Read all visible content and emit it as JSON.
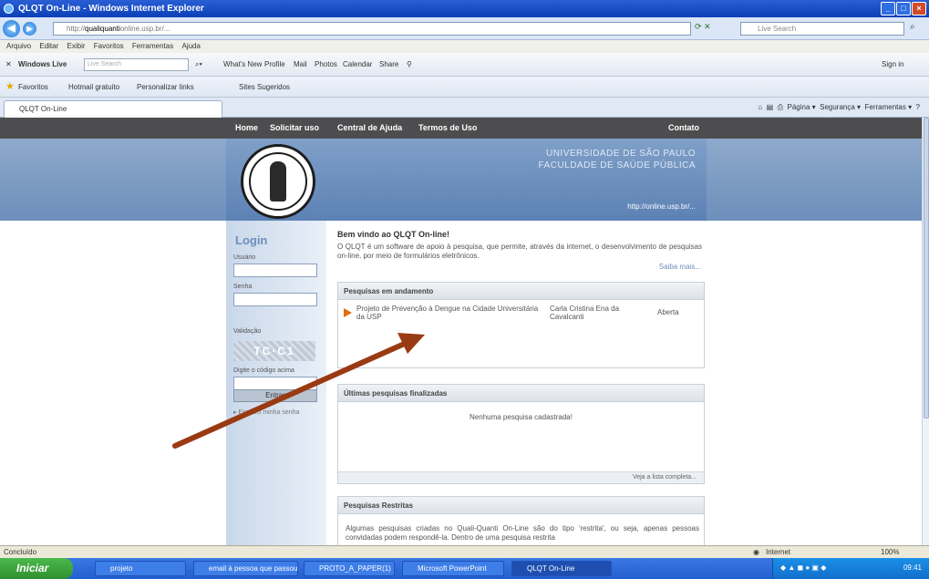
{
  "window": {
    "title": "QLQT On-Line - Windows Internet Explorer",
    "buttons": [
      "minimize",
      "maximize",
      "close"
    ]
  },
  "address": {
    "url_prefix": "http://",
    "url_strong": "qualiquanti",
    "url_rest": "online.usp.br/...",
    "search_placeholder": "Live Search"
  },
  "menu": [
    "Arquivo",
    "Editar",
    "Exibir",
    "Favoritos",
    "Ferramentas",
    "Ajuda"
  ],
  "toolbar2": {
    "windows_live": "Windows Live",
    "search_placeholder": "Live Search",
    "links": [
      "What's New",
      "Profile",
      "Mail",
      "Photos",
      "Calendar",
      "Share"
    ],
    "signin": "Sign in"
  },
  "favorites": {
    "label": "Favoritos",
    "items": [
      "Hotmail gratuito",
      "Personalizar links",
      "Sites Sugeridos"
    ]
  },
  "tab": {
    "title": "QLQT On-Line",
    "commands": [
      "Página",
      "Segurança",
      "Ferramentas"
    ]
  },
  "site": {
    "nav": [
      "Home",
      "Solicitar uso",
      "Central de Ajuda",
      "Termos de Uso",
      "Contato"
    ],
    "university": [
      "UNIVERSIDADE DE SÃO PAULO",
      "FACULDADE DE SAÚDE PÚBLICA"
    ],
    "url": "http://online.usp.br/..."
  },
  "login": {
    "title": "Login",
    "user_label": "Usuário",
    "password_label": "Senha",
    "validation_label": "Validação",
    "captcha": "TC·C1",
    "code_label": "Digite o código acima",
    "enter": "Entrar",
    "forgot": "Esqueci minha senha"
  },
  "main": {
    "welcome": "Bem vindo ao QLQT On-line!",
    "intro": "O QLQT é um software de apoio à pesquisa, que permite, através da internet, o desenvolvimento de pesquisas on-line, por meio de formulários eletrônicos.",
    "more": "Saiba mais...",
    "ongoing": {
      "title": "Pesquisas em andamento",
      "rows": [
        {
          "project": "Projeto de Prevenção à Dengue na Cidade Universitária da USP",
          "author": "Carla Cristina Ena da Cavalcanti",
          "status": "Aberta"
        }
      ]
    },
    "finished": {
      "title": "Últimas pesquisas finalizadas",
      "empty": "Nenhuma pesquisa cadastrada!",
      "link": "Veja a lista completa..."
    },
    "restricted": {
      "title": "Pesquisas Restritas",
      "text": "Algumas pesquisas criadas no Quali-Quanti On-Line são do tipo 'restrita', ou seja, apenas pessoas convidadas podem respondê-la. Dentro de uma pesquisa restrita"
    }
  },
  "status": {
    "left": "Concluído",
    "zone": "Internet",
    "zoom": "100%"
  },
  "taskbar": {
    "start": "Iniciar",
    "tasks": [
      "projeto",
      "email à pessoa que passou...",
      "PROTO_A_PAPER(1)",
      "Microsoft PowerPoint",
      "QLQT On-Line"
    ],
    "clock": "09:41"
  },
  "colors": {
    "arrow": "#9a3a12",
    "site_nav": "#4d4d4f",
    "banner": "#6d8fbb",
    "bullet": "#e06c10"
  }
}
